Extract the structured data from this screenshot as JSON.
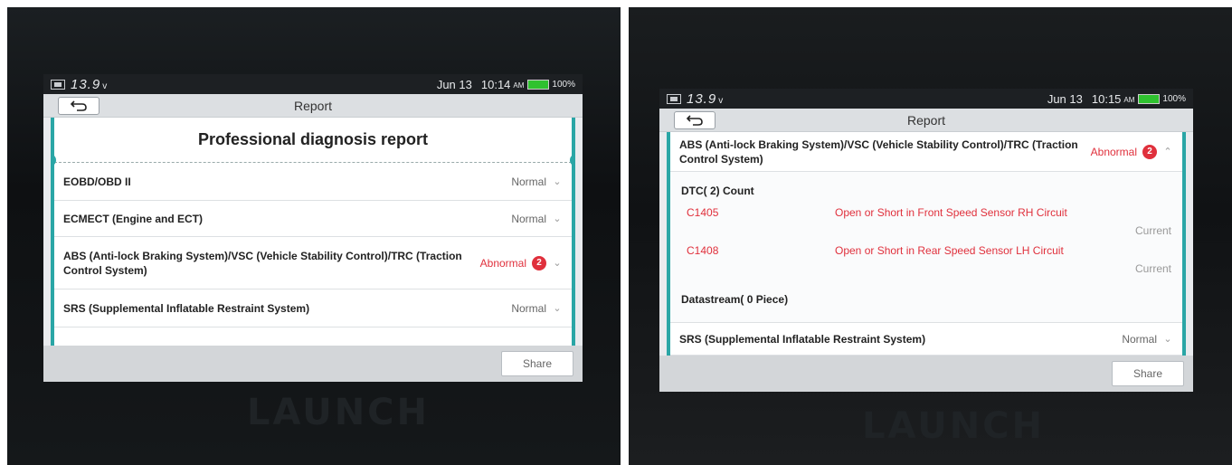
{
  "screen1": {
    "status": {
      "voltage": "13.9",
      "volt_unit": "v",
      "date": "Jun 13",
      "time": "10:14",
      "ampm": "AM",
      "battery_pct": "100%"
    },
    "title": "Report",
    "heading": "Professional diagnosis report",
    "rows": [
      {
        "label": "EOBD/OBD II",
        "status": "Normal"
      },
      {
        "label": "ECMECT (Engine and ECT)",
        "status": "Normal"
      },
      {
        "label": "ABS (Anti-lock Braking System)/VSC (Vehicle Stability Control)/TRC (Traction Control System)",
        "status": "Abnormal",
        "count": "2"
      },
      {
        "label": "SRS (Supplemental Inflatable Restraint System)",
        "status": "Normal"
      }
    ],
    "share_label": "Share"
  },
  "screen2": {
    "status": {
      "voltage": "13.9",
      "volt_unit": "v",
      "date": "Jun 13",
      "time": "10:15",
      "ampm": "AM",
      "battery_pct": "100%"
    },
    "title": "Report",
    "abs_row": {
      "label": "ABS (Anti-lock Braking System)/VSC (Vehicle Stability Control)/TRC (Traction Control System)",
      "status": "Abnormal",
      "count": "2"
    },
    "dtc_heading": "DTC( 2) Count",
    "dtcs": [
      {
        "code": "C1405",
        "description": "Open or Short in Front Speed Sensor RH Circuit",
        "state": "Current"
      },
      {
        "code": "C1408",
        "description": "Open or Short in Rear Speed Sensor LH Circuit",
        "state": "Current"
      }
    ],
    "datastream_heading": "Datastream( 0 Piece)",
    "srs_row": {
      "label": "SRS (Supplemental Inflatable Restraint System)",
      "status": "Normal"
    },
    "share_label": "Share"
  },
  "device_brand": "LAUNCH",
  "colors": {
    "accent": "#2aa6a6",
    "abnormal": "#e0303c",
    "battery": "#2fc22f"
  }
}
